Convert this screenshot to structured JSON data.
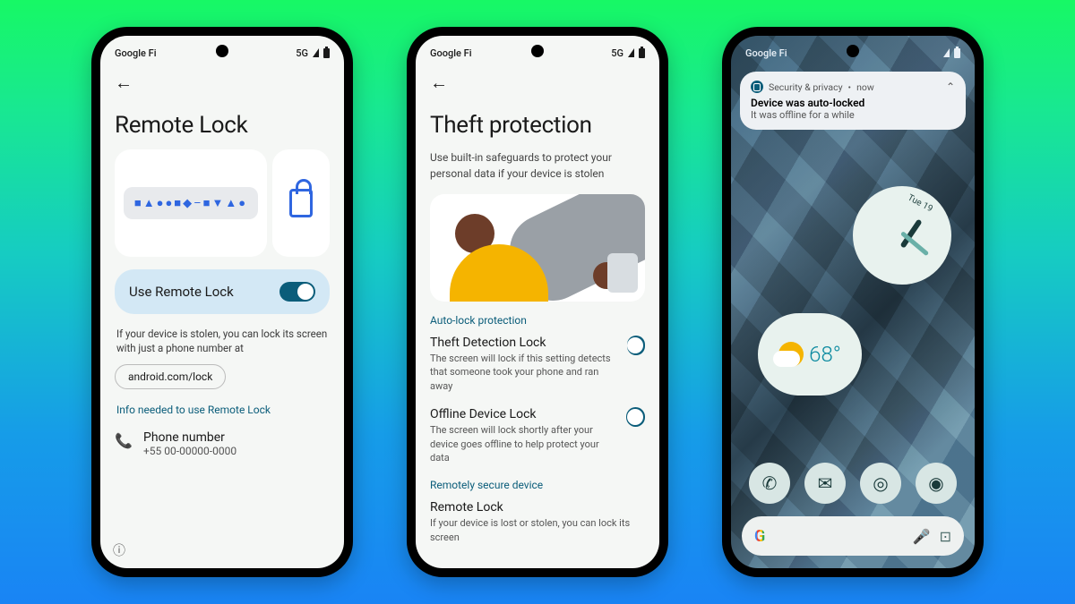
{
  "statusbar": {
    "carrier": "Google Fi",
    "net": "5G"
  },
  "phone1": {
    "title": "Remote Lock",
    "keyboard_glyphs": "■▲●●■◆–■▼▲●",
    "toggle_label": "Use Remote Lock",
    "desc": "If your device is stolen, you can lock its screen with just a phone number at",
    "pill": "android.com/lock",
    "link": "Info needed to use Remote Lock",
    "row_title": "Phone number",
    "row_sub": "+55 00-00000-0000"
  },
  "phone2": {
    "title": "Theft protection",
    "sub": "Use built-in safeguards to protect your personal data if your device is stolen",
    "section1": "Auto-lock protection",
    "opt1_t": "Theft Detection Lock",
    "opt1_s": "The screen will lock if this setting detects that someone took your phone and ran away",
    "opt2_t": "Offline Device Lock",
    "opt2_s": "The screen will lock shortly after your device goes offline to help protect your data",
    "section2": "Remotely secure device",
    "opt3_t": "Remote Lock",
    "opt3_s": "If your device is lost or stolen, you can lock its screen"
  },
  "phone3": {
    "notif_app": "Security & privacy",
    "notif_time": "now",
    "notif_title": "Device was auto-locked",
    "notif_body": "It was offline for a while",
    "clock_day": "Tue 19",
    "temp": "68°"
  }
}
